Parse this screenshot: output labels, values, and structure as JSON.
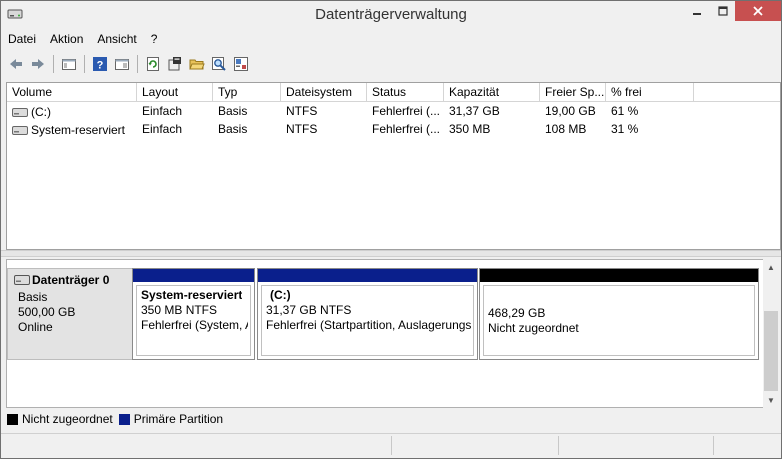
{
  "window": {
    "title": "Datenträgerverwaltung"
  },
  "menu": [
    "Datei",
    "Aktion",
    "Ansicht",
    "?"
  ],
  "toolbar_icons": [
    "back-arrow-icon",
    "forward-arrow-icon",
    "console-tree-icon",
    "help-icon",
    "properties-view-icon",
    "refresh-icon",
    "rescan-disks-icon",
    "open-folder-icon",
    "search-disk-icon",
    "settings-disk-icon"
  ],
  "table": {
    "columns": [
      "Volume",
      "Layout",
      "Typ",
      "Dateisystem",
      "Status",
      "Kapazität",
      "Freier Sp...",
      "% frei"
    ],
    "rows": [
      [
        "(C:)",
        "Einfach",
        "Basis",
        "NTFS",
        "Fehlerfrei (...",
        "31,37 GB",
        "19,00 GB",
        "61 %"
      ],
      [
        "System-reserviert",
        "Einfach",
        "Basis",
        "NTFS",
        "Fehlerfrei (...",
        "350 MB",
        "108 MB",
        "31 %"
      ]
    ]
  },
  "disk": {
    "name": "Datenträger 0",
    "type": "Basis",
    "size": "500,00 GB",
    "state": "Online",
    "partitions": [
      {
        "title": "System-reserviert",
        "size": "350 MB NTFS",
        "status": "Fehlerfrei (System, A",
        "color": "#0a1f8c"
      },
      {
        "title": "(C:)",
        "size": "31,37 GB NTFS",
        "status": "Fehlerfrei (Startpartition, Auslagerungsc",
        "color": "#0a1f8c"
      },
      {
        "title": "",
        "size": "468,29 GB",
        "status": "Nicht zugeordnet",
        "color": "#000000"
      }
    ]
  },
  "legend": [
    {
      "label": "Nicht zugeordnet",
      "color": "#000000"
    },
    {
      "label": "Primäre Partition",
      "color": "#0a1f8c"
    }
  ]
}
